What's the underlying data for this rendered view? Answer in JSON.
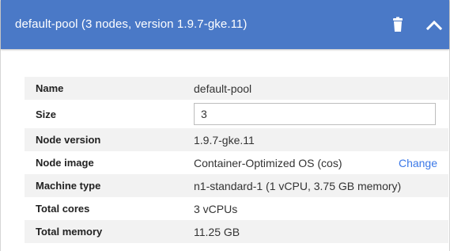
{
  "header": {
    "title": "default-pool (3 nodes, version 1.9.7-gke.11)",
    "delete_icon": "trash-icon",
    "collapse_icon": "chevron-up-icon",
    "color": "#4a79c7"
  },
  "details": {
    "name": {
      "label": "Name",
      "value": "default-pool"
    },
    "size": {
      "label": "Size",
      "value": "3"
    },
    "node_version": {
      "label": "Node version",
      "value": "1.9.7-gke.11"
    },
    "node_image": {
      "label": "Node image",
      "value": "Container-Optimized OS (cos)",
      "action": "Change"
    },
    "machine_type": {
      "label": "Machine type",
      "value": "n1-standard-1 (1 vCPU, 3.75 GB memory)"
    },
    "total_cores": {
      "label": "Total cores",
      "value": "3 vCPUs"
    },
    "total_memory": {
      "label": "Total memory",
      "value": "11.25 GB"
    }
  }
}
